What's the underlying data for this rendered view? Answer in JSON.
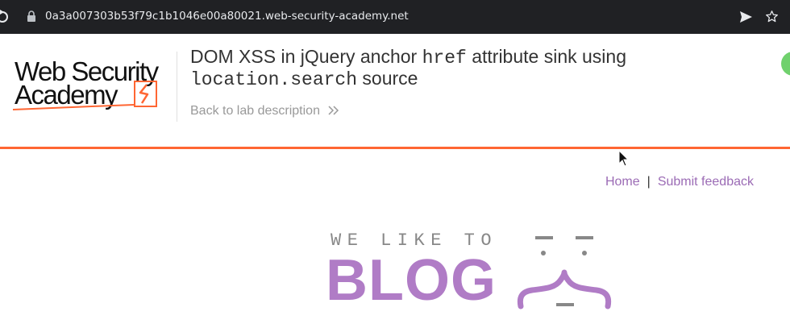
{
  "browser": {
    "url": "0a3a007303b53f79c1b1046e00a80021.web-security-academy.net"
  },
  "lab_header": {
    "logo_line1": "Web Security",
    "logo_line2": "Academy",
    "title_part1": "DOM XSS in jQuery anchor ",
    "title_code1": "href",
    "title_part2": " attribute sink using",
    "title_code2": "location.search",
    "title_part3": " source",
    "back_link": "Back to lab description",
    "status_color": "#70d16d",
    "accent_color": "#ff6633"
  },
  "nav": {
    "home": "Home",
    "separator": "|",
    "feedback": "Submit feedback",
    "link_color": "#9b6bb5"
  },
  "banner": {
    "tagline": "WE LIKE TO",
    "word": "BLOG",
    "word_color": "#b07cc6",
    "icon": "face-brace-icon"
  }
}
